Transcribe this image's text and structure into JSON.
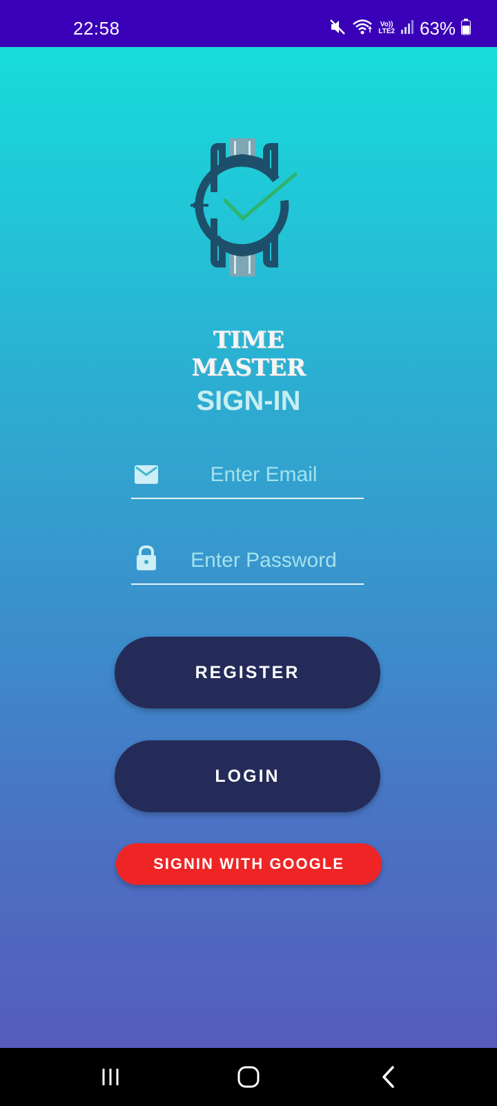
{
  "status_bar": {
    "time": "22:58",
    "lte_line1": "Vo))",
    "lte_line2": "LTE2",
    "battery_percent": "63%",
    "battery_level": 0.63,
    "icons": [
      "mute-icon",
      "wifi-icon",
      "volte-icon",
      "signal-icon",
      "battery-icon"
    ]
  },
  "app": {
    "logo_text": "TIME MASTER",
    "title": "SIGN-IN",
    "email": {
      "placeholder": "Enter Email",
      "value": "",
      "icon": "email-icon"
    },
    "password": {
      "placeholder": "Enter Password",
      "value": "",
      "icon": "lock-icon"
    },
    "buttons": {
      "register": "REGISTER",
      "login": "LOGIN",
      "google": "SIGNIN WITH GOOGLE"
    },
    "colors": {
      "gradient_top": "#17dcdc",
      "gradient_bottom": "#565cbc",
      "primary_button": "#252b58",
      "google_button": "#ef2525",
      "status_bar": "#3a00b8"
    }
  },
  "nav_bar": {
    "icons": [
      "recent-apps-icon",
      "home-icon",
      "back-icon"
    ]
  }
}
